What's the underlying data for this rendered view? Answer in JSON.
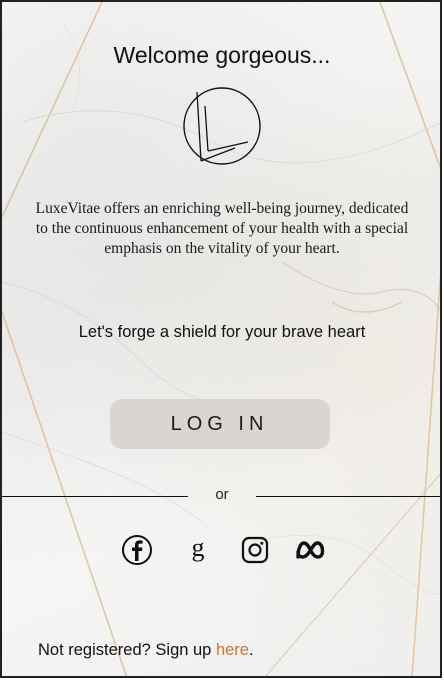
{
  "welcome_text": "Welcome gorgeous...",
  "description": "LuxeVitae offers an enriching well-being journey, dedicated to the continuous enhancement of your health with a special emphasis on the vitality of your heart.",
  "tagline": "Let's forge a shield for your brave heart",
  "login_label": "LOG IN",
  "divider_label": "or",
  "social_icons": [
    "facebook-icon",
    "google-icon",
    "instagram-icon",
    "meta-icon"
  ],
  "google_glyph": "g",
  "signup": {
    "prompt": "Not registered? Sign up ",
    "link_text": "here",
    "end": "."
  },
  "colors": {
    "link": "#c07a3e",
    "button": "#d9d5d2",
    "vein": "#d8b98a",
    "text": "#111111"
  }
}
